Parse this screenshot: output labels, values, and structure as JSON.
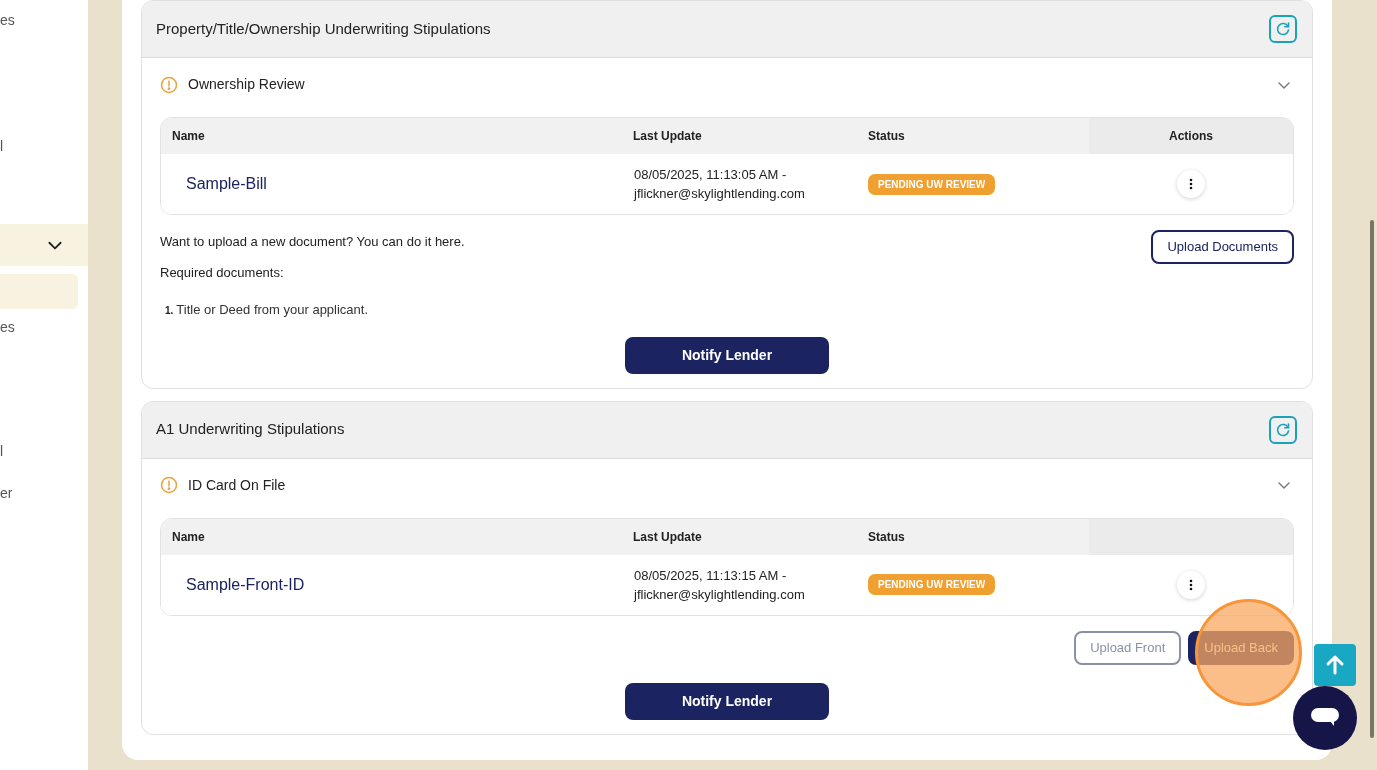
{
  "sidebar": {
    "items": [
      {
        "label": "es",
        "selected": false
      },
      {
        "label": "l",
        "selected": false
      },
      {
        "kind": "group",
        "expanded": true,
        "selected": false,
        "children": [
          {
            "selected": true
          },
          {
            "label": "es",
            "selected": false
          },
          {
            "label": "l",
            "selected": false
          },
          {
            "label": "er",
            "selected": false
          }
        ]
      }
    ]
  },
  "sections": [
    {
      "title": "Property/Title/Ownership Underwriting Stipulations",
      "stipulations": [
        {
          "title": "Ownership Review",
          "kind": "pending",
          "expanded": true,
          "table": {
            "columns": [
              "Name",
              "Last Update",
              "Status",
              "Actions"
            ],
            "rows": [
              {
                "name": "Sample-Bill",
                "last_update": "08/05/2025, 11:13:05 AM - jflickner@skylightlending.com",
                "status": "PENDING UW REVIEW"
              }
            ]
          },
          "upload_prompt": "Want to upload a new document? You can do it here.",
          "buttons": [
            {
              "label": "Upload Documents",
              "kind": "outline"
            }
          ],
          "required_label": "Required documents:",
          "required_documents": [
            {
              "number": "1.",
              "text": "Title or Deed from your applicant."
            }
          ],
          "notify_button": "Notify Lender"
        }
      ]
    },
    {
      "title": "A1 Underwriting Stipulations",
      "stipulations": [
        {
          "title": "ID Card On File",
          "kind": "pending",
          "expanded": true,
          "table": {
            "columns": [
              "Name",
              "Last Update",
              "Status"
            ],
            "rows": [
              {
                "name": "Sample-Front-ID",
                "last_update": "08/05/2025, 11:13:15 AM - jflickner@skylightlending.com",
                "status": "PENDING UW REVIEW"
              }
            ]
          },
          "buttons": [
            {
              "label": "Upload Front",
              "kind": "muted"
            },
            {
              "label": "Upload Back",
              "kind": "solid"
            }
          ],
          "notify_button": "Notify Lender"
        }
      ]
    }
  ]
}
